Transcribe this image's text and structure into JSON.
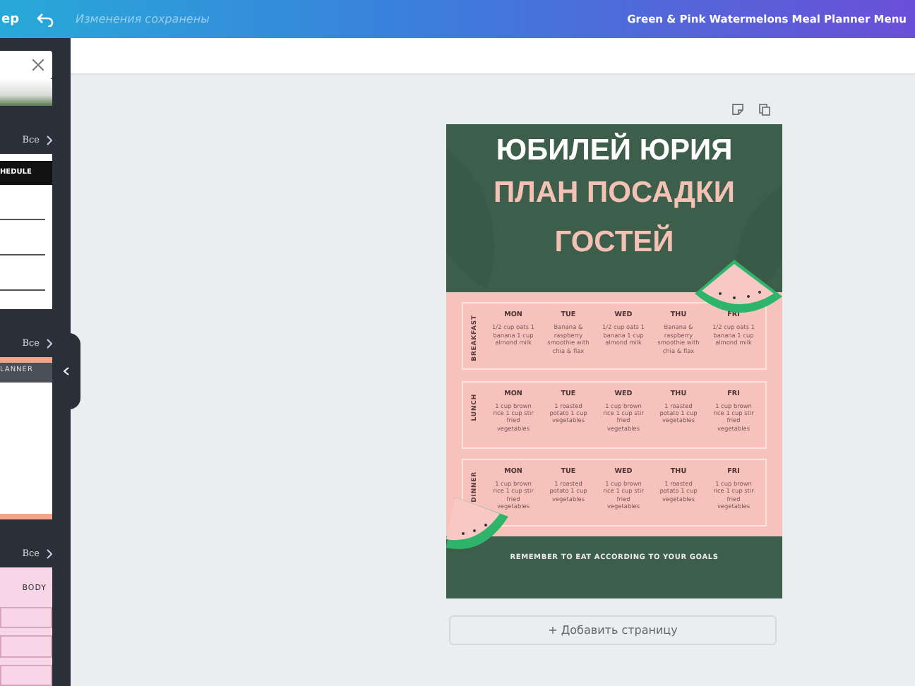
{
  "topbar": {
    "cut_button": "ер",
    "status": "Изменения сохранены",
    "title": "Green & Pink Watermelons Meal Planner Menu"
  },
  "sidebar": {
    "groups": [
      {
        "see_all": "Все",
        "thumbnail": {
          "kind": "schedule",
          "text": "HEDULE"
        }
      },
      {
        "see_all": "Все",
        "thumbnail": {
          "kind": "planner",
          "text": "LANNER"
        }
      },
      {
        "see_all": "Все",
        "thumbnail": {
          "kind": "body",
          "text": "BODY"
        }
      }
    ]
  },
  "design": {
    "title_lines": [
      {
        "kind": "headline",
        "text": "ЮБИЛЕЙ ЮРИЯ"
      },
      {
        "kind": "subhead",
        "text": "ПЛАН ПОСАДКИ"
      },
      {
        "kind": "subhead",
        "text": "ГОСТЕЙ"
      }
    ],
    "meals": [
      {
        "label": "BREAKFAST",
        "days": [
          {
            "day": "MON",
            "menu": "1/2 cup oats 1 banana 1 cup almond milk"
          },
          {
            "day": "TUE",
            "menu": "Banana & raspberry smoothie with chia & flax"
          },
          {
            "day": "WED",
            "menu": "1/2 cup oats 1 banana 1 cup almond milk"
          },
          {
            "day": "THU",
            "menu": "Banana & raspberry smoothie with chia & flax"
          },
          {
            "day": "FRI",
            "menu": "1/2 cup oats 1 banana 1 cup almond milk"
          }
        ]
      },
      {
        "label": "LUNCH",
        "days": [
          {
            "day": "MON",
            "menu": "1 cup brown rice 1 cup stir fried vegetables"
          },
          {
            "day": "TUE",
            "menu": "1 roasted potato 1 cup vegetables"
          },
          {
            "day": "WED",
            "menu": "1 cup brown rice 1 cup stir fried vegetables"
          },
          {
            "day": "THU",
            "menu": "1 roasted potato 1 cup vegetables"
          },
          {
            "day": "FRI",
            "menu": "1 cup brown rice 1 cup stir fried vegetables"
          }
        ]
      },
      {
        "label": "DINNER",
        "days": [
          {
            "day": "MON",
            "menu": "1 cup brown rice 1 cup stir fried vegetables"
          },
          {
            "day": "TUE",
            "menu": "1 roasted potato 1 cup vegetables"
          },
          {
            "day": "WED",
            "menu": "1 cup brown rice 1 cup stir fried vegetables"
          },
          {
            "day": "THU",
            "menu": "1 roasted potato 1 cup vegetables"
          },
          {
            "day": "FRI",
            "menu": "1 cup brown rice 1 cup stir fried vegetables"
          }
        ]
      }
    ],
    "footer": "REMEMBER TO EAT ACCORDING TO YOUR GOALS"
  },
  "add_page": "+ Добавить страницу"
}
